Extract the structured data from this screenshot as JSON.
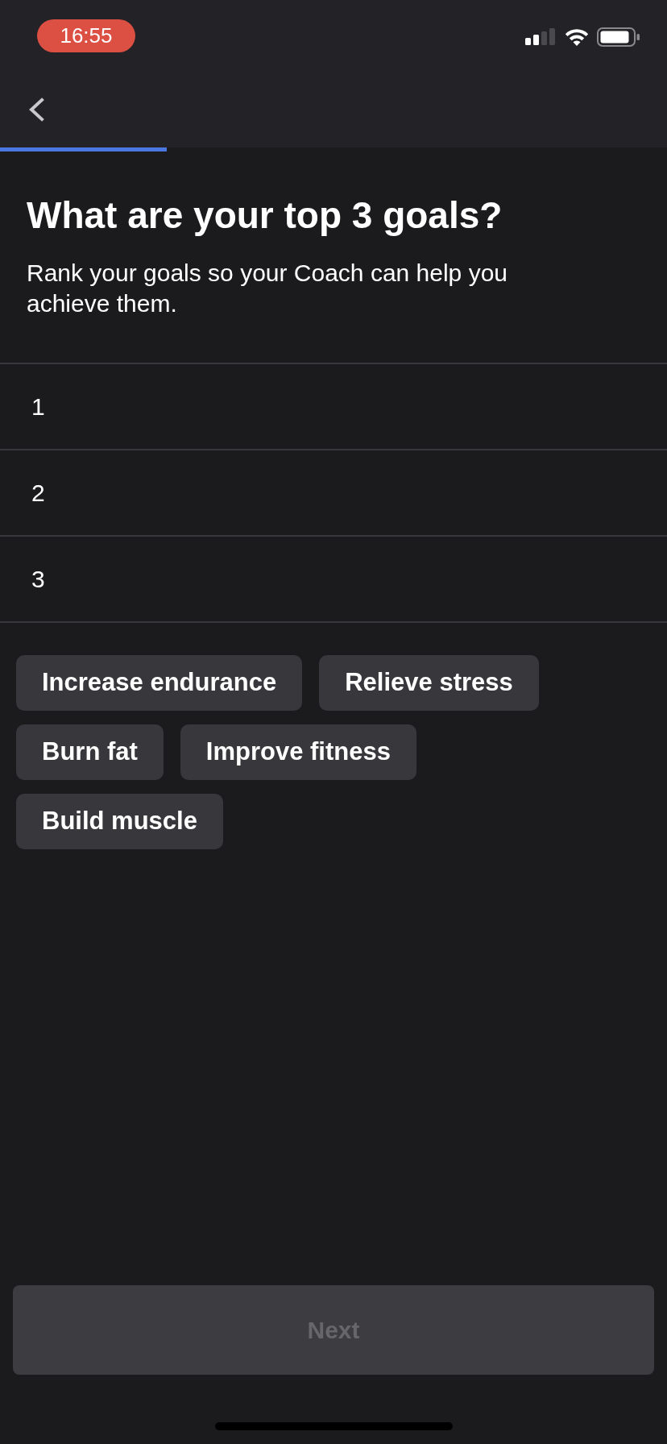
{
  "status_bar": {
    "time": "16:55"
  },
  "nav": {
    "progress": {
      "level": 0.25
    }
  },
  "question": {
    "title": "What are your top 3 goals?",
    "subtitle": "Rank your goals so your Coach can help you achieve them."
  },
  "ranking_slots": [
    {
      "label": "1"
    },
    {
      "label": "2"
    },
    {
      "label": "3"
    }
  ],
  "goal_options": [
    {
      "label": "Increase endurance",
      "selected": false
    },
    {
      "label": "Relieve stress",
      "selected": false
    },
    {
      "label": "Burn fat",
      "selected": false
    },
    {
      "label": "Improve fitness",
      "selected": false
    },
    {
      "label": "Build muscle",
      "selected": false
    }
  ],
  "next_button": {
    "label": "Next",
    "disabled": true
  }
}
